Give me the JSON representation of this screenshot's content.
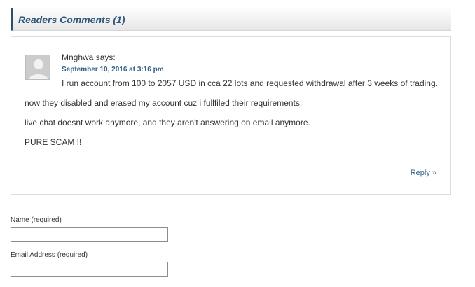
{
  "comments_section": {
    "title": "Readers Comments (1)"
  },
  "comment": {
    "author": "Mnghwa",
    "says": "says:",
    "date": "September 10, 2016 at 3:16 pm",
    "paragraphs": [
      "I run account from 100 to 2057 USD in cca 22 lots and requested withdrawal after 3 weeks of trading.",
      "now they disabled and erased my account cuz i fullfiled their requirements.",
      "live chat doesnt work anymore, and they aren't answering on email anymore.",
      "PURE SCAM !!"
    ],
    "reply_label": "Reply »",
    "avatar_icon": "user-avatar-placeholder"
  },
  "form": {
    "name_label": "Name (required)",
    "name_value": "",
    "email_label": "Email Address (required)",
    "email_value": ""
  },
  "colors": {
    "accent": "#2c4f6e",
    "link": "#2f5f87"
  }
}
